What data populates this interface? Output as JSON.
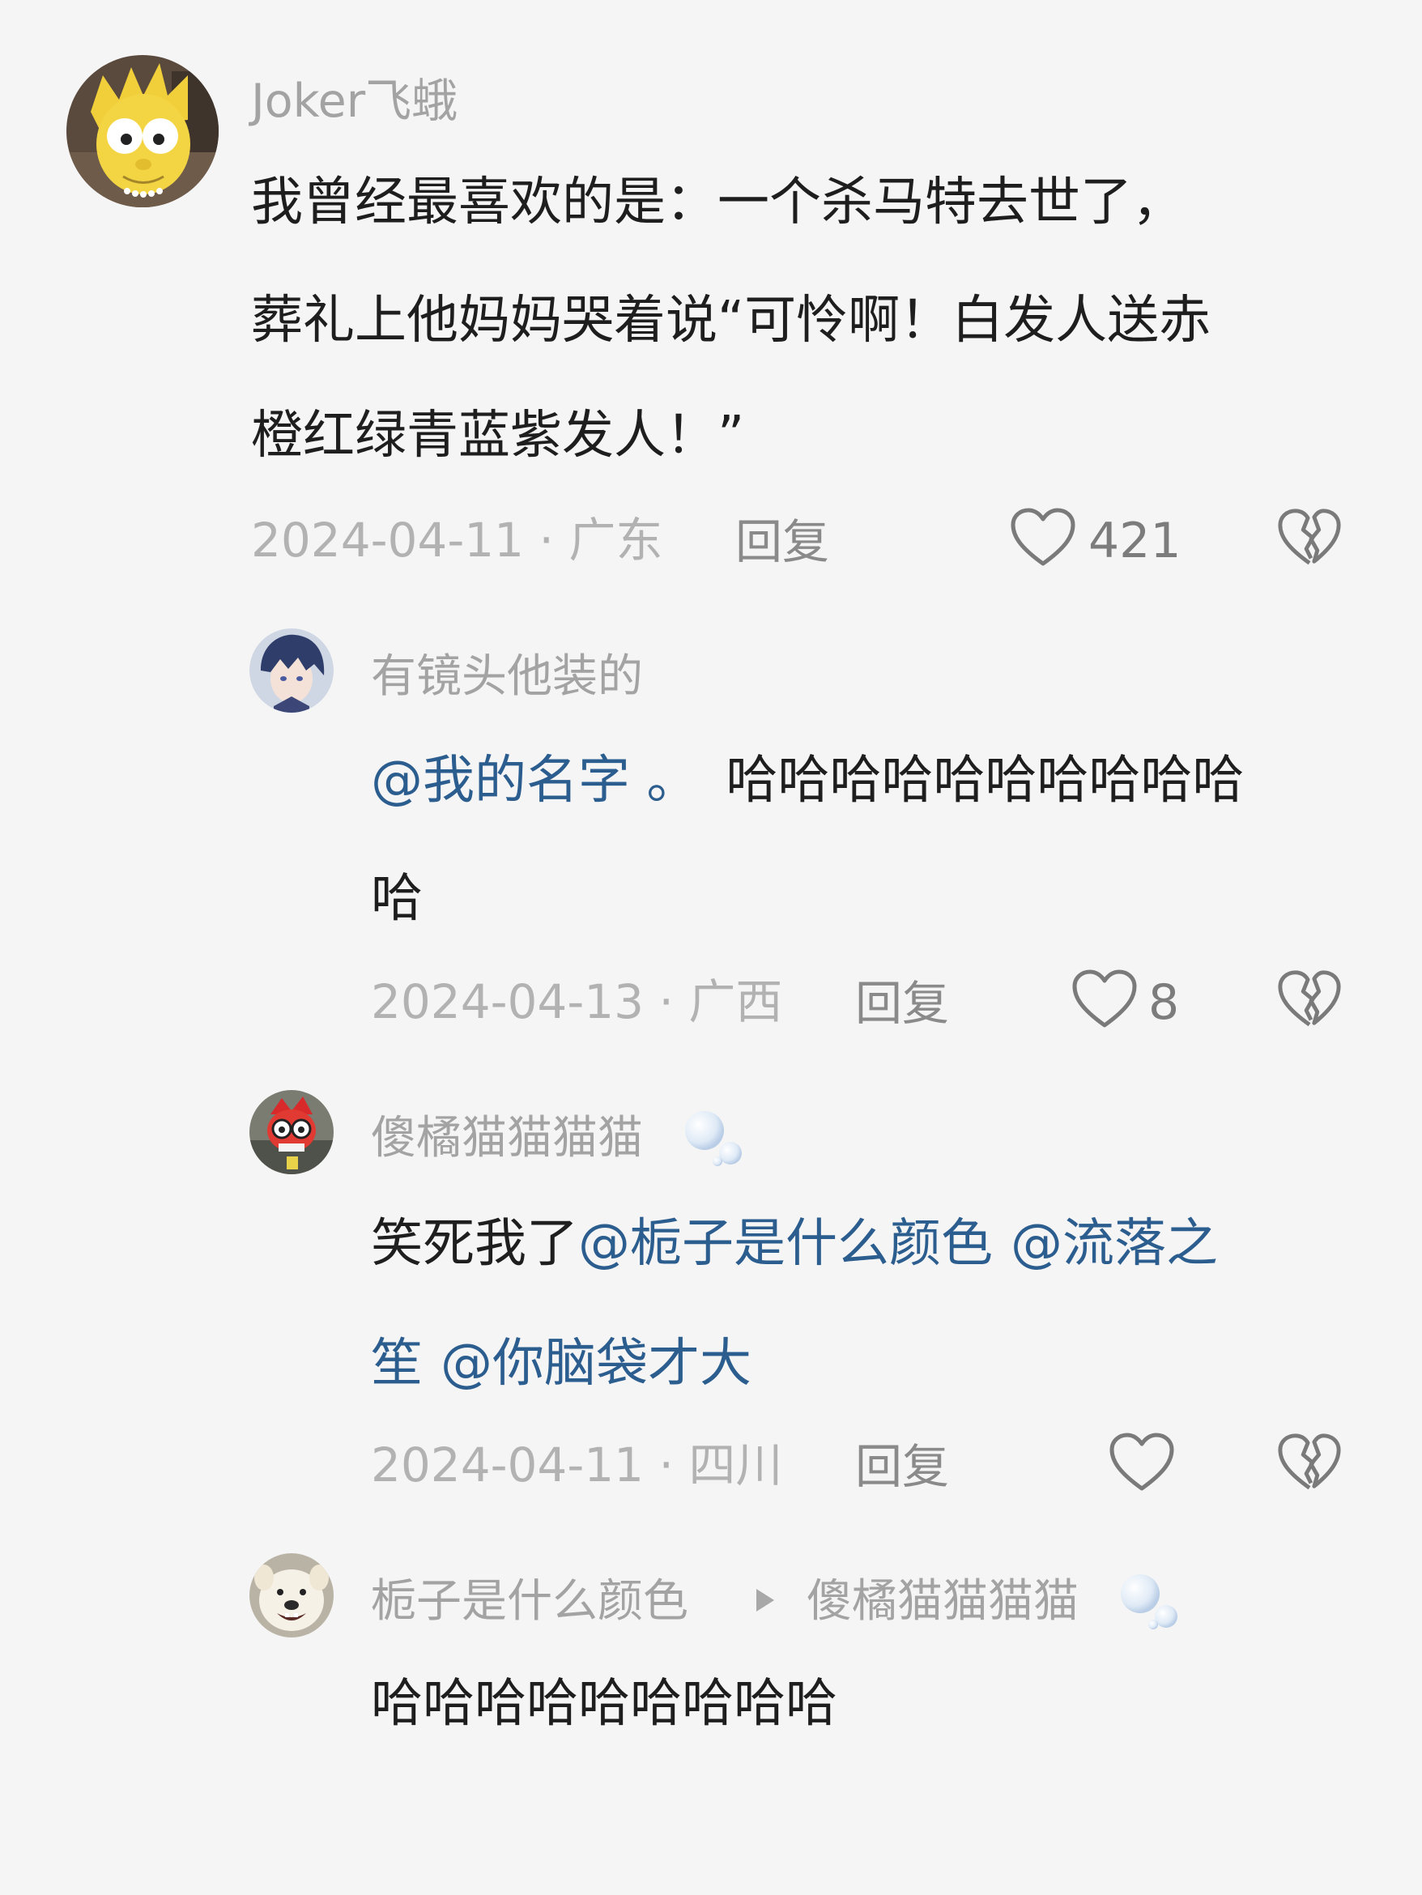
{
  "comments": [
    {
      "username": "Joker飞蛾",
      "lines": [
        "我曾经最喜欢的是：一个杀马特去世了，",
        "葬礼上他妈妈哭着说“可怜啊！白发人送赤",
        "橙红绿青蓝紫发人！”"
      ],
      "date": "2024-04-11",
      "location": "广东",
      "reply_label": "回复",
      "likes": "421"
    },
    {
      "username": "有镜头他装的",
      "mention_1": "@我的名字 。",
      "text_1": "哈哈哈哈哈哈哈哈哈哈",
      "text_2": "哈",
      "date": "2024-04-13",
      "location": "广西",
      "reply_label": "回复",
      "likes": "8"
    },
    {
      "username": "傻橘猫猫猫猫",
      "text_1": "笑死我了",
      "mention_1": "@栀子是什么颜色",
      "mention_2": "@流落之",
      "mention_3": "笙",
      "mention_4": "@你脑袋才大",
      "date": "2024-04-11",
      "location": "四川",
      "reply_label": "回复",
      "likes": ""
    },
    {
      "username": "栀子是什么颜色",
      "reply_to": "傻橘猫猫猫猫",
      "text_1": "哈哈哈哈哈哈哈哈哈"
    }
  ],
  "separator": "·",
  "colors": {
    "background": "#f5f5f5",
    "mention": "#2c5d8f",
    "username": "#a3a3a3",
    "meta": "#b2b2b2"
  },
  "icons": {
    "like": "heart-outline-icon",
    "dislike": "broken-heart-icon",
    "reply_arrow": "triangle-right-icon",
    "badge": "bubble-icon"
  }
}
